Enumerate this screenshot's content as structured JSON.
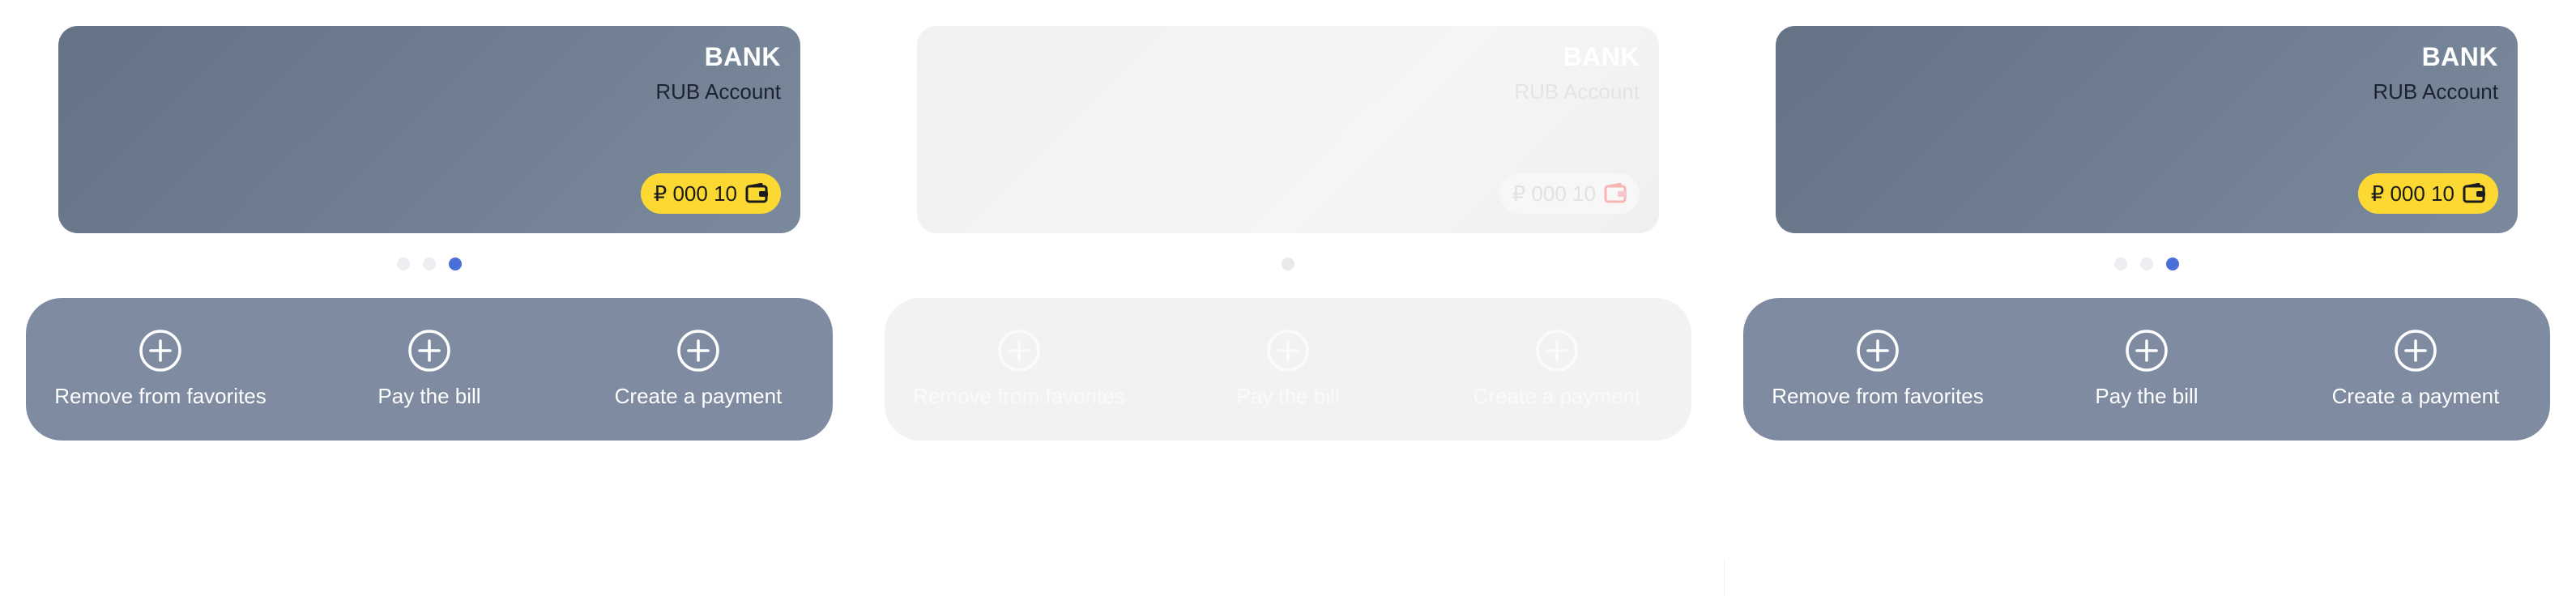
{
  "accent_colors": {
    "card": "#647486",
    "actions_panel": "#7e8ba0",
    "balance_badge": "#fcd932",
    "pager_active": "#4a6fd6"
  },
  "variants": [
    {
      "card": {
        "bank": "BANK",
        "account": "RUB Account",
        "balance": "₽ 000 10",
        "balance_icon": "wallet-icon"
      },
      "actions": [
        {
          "label": "Remove from favorites",
          "icon": "plus-circle-icon"
        },
        {
          "label": "Pay the bill",
          "icon": "plus-circle-icon"
        },
        {
          "label": "Create a payment",
          "icon": "plus-circle-icon"
        }
      ]
    },
    {
      "card": {
        "bank": "BANK",
        "account": "RUB Account",
        "balance": "₽ 000 10",
        "balance_icon": "wallet-icon"
      },
      "actions": [
        {
          "label": "Remove from favorites",
          "icon": "plus-circle-icon"
        },
        {
          "label": "Pay the bill",
          "icon": "plus-circle-icon"
        },
        {
          "label": "Create a payment",
          "icon": "plus-circle-icon"
        }
      ]
    },
    {
      "card": {
        "bank": "BANK",
        "account": "RUB Account",
        "balance": "₽ 000 10",
        "balance_icon": "wallet-icon"
      },
      "actions": [
        {
          "label": "Remove from favorites",
          "icon": "plus-circle-icon"
        },
        {
          "label": "Pay the bill",
          "icon": "plus-circle-icon"
        },
        {
          "label": "Create a payment",
          "icon": "plus-circle-icon"
        }
      ]
    }
  ]
}
